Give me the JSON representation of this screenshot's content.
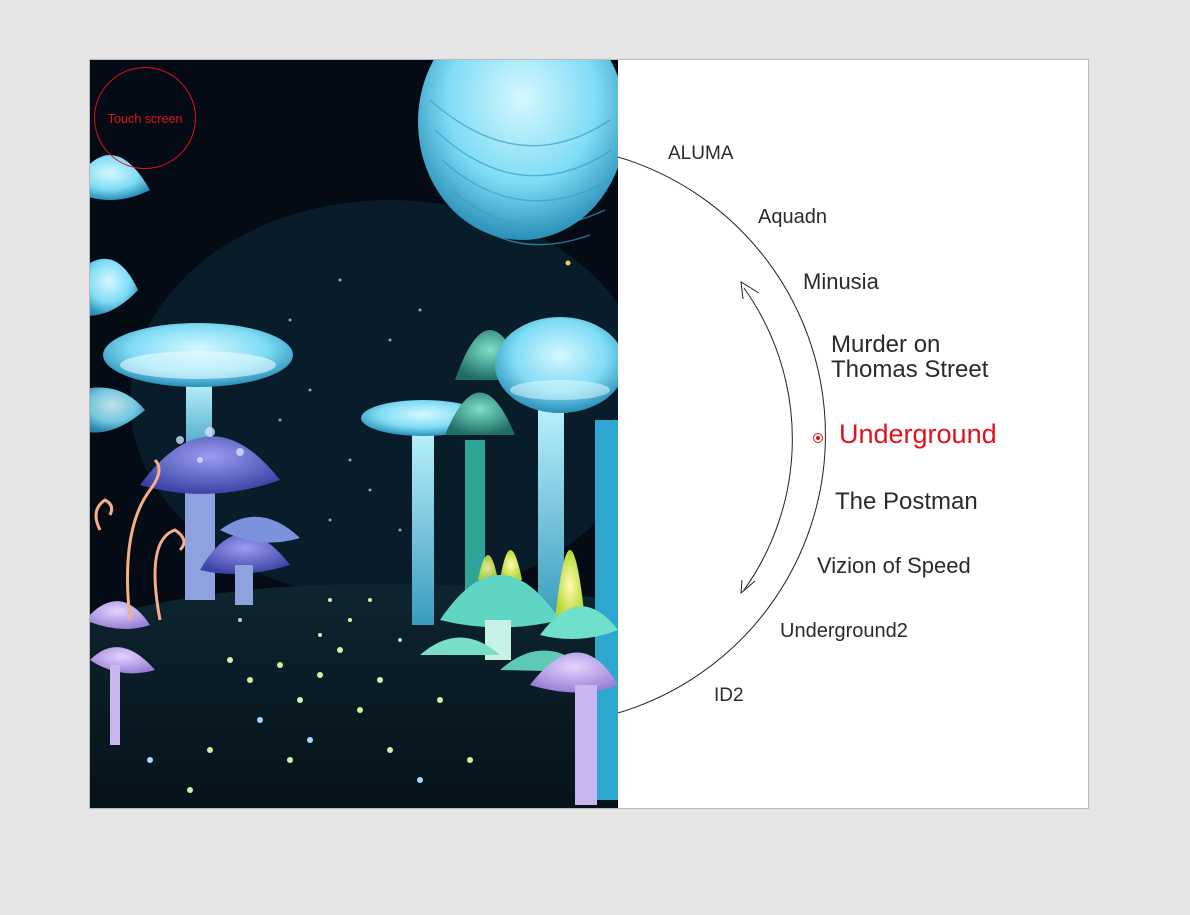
{
  "touch_label": "Touch screen",
  "accent_color": "#e0121b",
  "selected_index": 4,
  "menu": {
    "items": [
      {
        "label": "ALUMA"
      },
      {
        "label": "Aquadn"
      },
      {
        "label": "Minusia"
      },
      {
        "label": "Murder on Thomas Street"
      },
      {
        "label": "Underground"
      },
      {
        "label": "The Postman"
      },
      {
        "label": "Vizion of Speed"
      },
      {
        "label": "Underground2"
      },
      {
        "label": "ID2"
      }
    ]
  },
  "icons": {
    "scroll_up": "arrow-up-icon",
    "scroll_down": "arrow-down-icon",
    "selected_marker": "selected-dot-icon"
  }
}
